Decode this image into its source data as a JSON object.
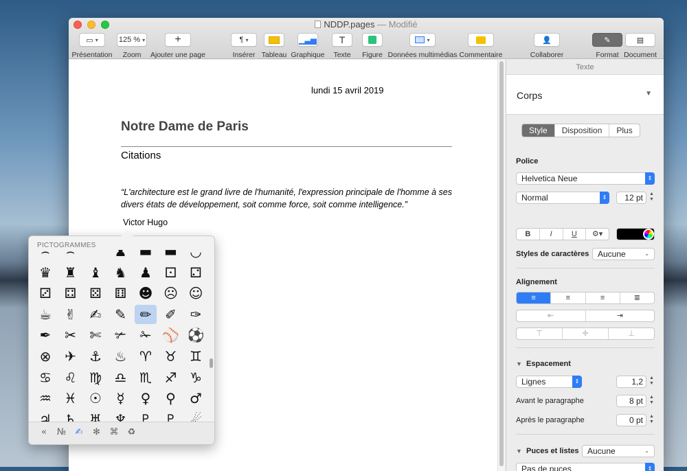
{
  "window": {
    "filename": "NDDP.pages",
    "separator": " — ",
    "status": "Modifié"
  },
  "toolbar": {
    "presentation": {
      "label": "Présentation"
    },
    "zoom": {
      "value": "125 %",
      "label": "Zoom"
    },
    "add_page": {
      "label": "Ajouter une page"
    },
    "insert": {
      "label": "Insérer"
    },
    "table": {
      "label": "Tableau"
    },
    "chart": {
      "label": "Graphique"
    },
    "text": {
      "label": "Texte"
    },
    "shape": {
      "label": "Figure"
    },
    "media": {
      "label": "Données multimédias"
    },
    "comment": {
      "label": "Commentaire"
    },
    "collaborate": {
      "label": "Collaborer"
    },
    "format": {
      "label": "Format"
    },
    "document": {
      "label": "Document"
    }
  },
  "document": {
    "date": "lundi 15 avril 2019",
    "title": "Notre Dame de Paris",
    "subtitle": "Citations",
    "quote": "“L'architecture est le grand livre de l'humanité, l'expression principale de l'homme à ses divers états de développement, soit comme force, soit comme intelligence.”",
    "author": "Victor Hugo"
  },
  "inspector": {
    "header": "Texte",
    "paragraph_style": "Corps",
    "tabs": [
      "Style",
      "Disposition",
      "Plus"
    ],
    "font_section": "Police",
    "font_family": "Helvetica Neue",
    "font_typeface": "Normal",
    "font_size": "12 pt",
    "bold": "B",
    "italic": "I",
    "underline": "U",
    "char_styles_label": "Styles de caractères",
    "char_styles_value": "Aucune",
    "alignment_section": "Alignement",
    "spacing_section": "Espacement",
    "line_spacing_mode": "Lignes",
    "line_spacing_value": "1,2",
    "before_label": "Avant le paragraphe",
    "before_value": "8 pt",
    "after_label": "Après le paragraphe",
    "after_value": "0 pt",
    "bullets_section": "Puces et listes",
    "bullets_value": "Aucune",
    "bullets_type": "Pas de puces",
    "colors": {
      "accent": "#2f7cf6",
      "text_color": "#000000"
    }
  },
  "popover": {
    "header": "PICTOGRAMMES",
    "glyphs": [
      [
        "⌢",
        "⌢",
        "⏜",
        "♟",
        "▬",
        "▬",
        "◡"
      ],
      [
        "♛",
        "♜",
        "♝",
        "♞",
        "♟",
        "⚀",
        "⚁"
      ],
      [
        "⚂",
        "⚃",
        "⚄",
        "⚅",
        "☻",
        "☹",
        "☺"
      ],
      [
        "☕",
        "✌",
        "✍",
        "✎",
        "✏",
        "✐",
        "✑"
      ],
      [
        "✒",
        "✂",
        "✄",
        "✃",
        "✁",
        "⚾",
        "⚽"
      ],
      [
        "⊗",
        "✈",
        "⚓",
        "♨",
        "♈",
        "♉",
        "♊"
      ],
      [
        "♋",
        "♌",
        "♍",
        "♎",
        "♏",
        "♐",
        "♑"
      ],
      [
        "♒",
        "♓",
        "☉",
        "☿",
        "♀",
        "⚲",
        "♂"
      ],
      [
        "♃",
        "♄",
        "♅",
        "♆",
        "♇",
        "♇",
        "☄"
      ]
    ],
    "selected": "✏",
    "categories": [
      "«",
      "№",
      "✍",
      "✻",
      "⌘",
      "♻"
    ],
    "active_category": 2
  }
}
